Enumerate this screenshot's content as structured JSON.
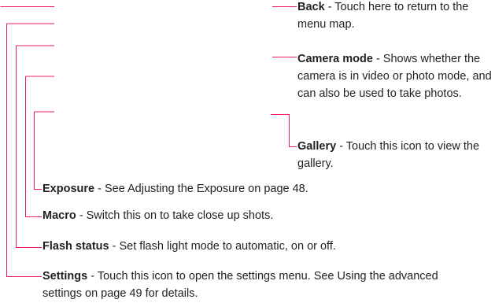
{
  "callouts": {
    "back": {
      "term": "Back",
      "description": " - Touch here to return to the menu map."
    },
    "camera_mode": {
      "term": "Camera mode",
      "description": " - Shows whether the camera is in video or photo mode, and can also be used to take photos."
    },
    "gallery": {
      "term": "Gallery",
      "description": " - Touch this icon to view the gallery."
    },
    "exposure": {
      "term": "Exposure",
      "description": " - See Adjusting the Exposure on page 48."
    },
    "macro": {
      "term": "Macro",
      "description": " - Switch this on to take close up shots."
    },
    "flash_status": {
      "term": "Flash status",
      "description": " - Set flash light mode to automatic, on or off."
    },
    "settings": {
      "term": "Settings",
      "description": " - Touch this icon to open the settings menu. See Using the advanced settings on page 49  for details."
    }
  },
  "colors": {
    "leader_line": "#ed1c5b",
    "text": "#231f20"
  }
}
